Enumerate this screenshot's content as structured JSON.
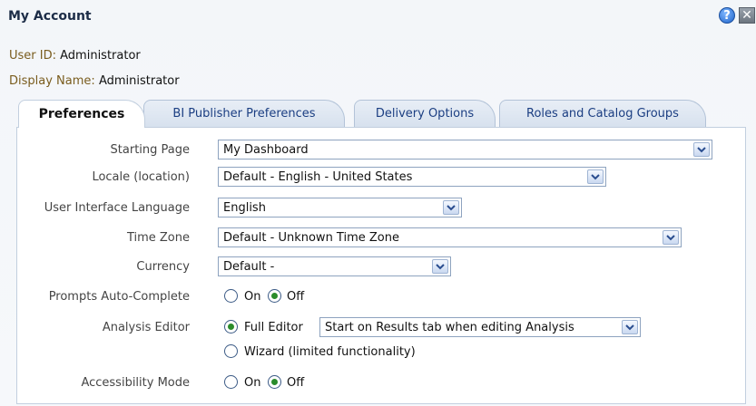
{
  "dialog": {
    "title": "My Account",
    "help_icon": "help-icon",
    "close_icon": "close-icon"
  },
  "user": {
    "id_label": "User ID:",
    "id_value": "Administrator",
    "display_label": "Display Name:",
    "display_value": "Administrator"
  },
  "tabs": [
    {
      "label": "Preferences",
      "active": true
    },
    {
      "label": "BI Publisher Preferences",
      "active": false
    },
    {
      "label": "Delivery Options",
      "active": false
    },
    {
      "label": "Roles and Catalog Groups",
      "active": false
    }
  ],
  "preferences": {
    "starting_page": {
      "label": "Starting Page",
      "value": "My Dashboard"
    },
    "locale": {
      "label": "Locale (location)",
      "value": "Default - English - United States"
    },
    "ui_language": {
      "label": "User Interface Language",
      "value": "English"
    },
    "time_zone": {
      "label": "Time Zone",
      "value": "Default - Unknown Time Zone"
    },
    "currency": {
      "label": "Currency",
      "value": "Default -"
    },
    "prompts_auto_complete": {
      "label": "Prompts Auto-Complete",
      "on_label": "On",
      "off_label": "Off",
      "selected": "Off"
    },
    "analysis_editor": {
      "label": "Analysis Editor",
      "full_label": "Full Editor",
      "full_select_value": "Start on Results tab when editing Analysis",
      "wizard_label": "Wizard (limited functionality)",
      "selected": "Full Editor"
    },
    "accessibility_mode": {
      "label": "Accessibility Mode",
      "on_label": "On",
      "off_label": "Off",
      "selected": "Off"
    }
  },
  "colors": {
    "title": "#1c2c47",
    "info_label": "#7a5c1e",
    "tab_text": "#1b3e82",
    "radio_checked": "#2b8c2b"
  }
}
